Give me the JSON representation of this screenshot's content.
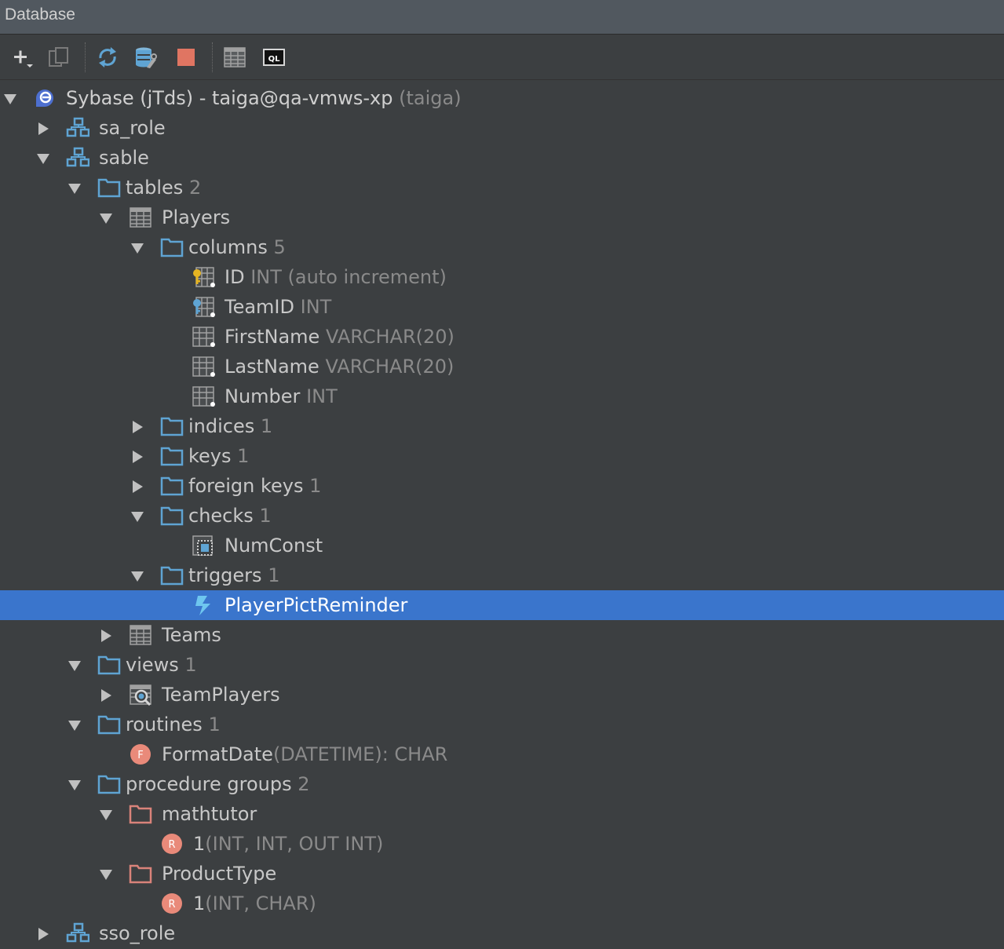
{
  "window": {
    "title": "Database"
  },
  "colors": {
    "selection": "#3a75cc",
    "folder": "#5fa4d3",
    "proc_folder": "#d9837a",
    "routine_badge": "#e98a7a"
  },
  "toolbar": {
    "buttons": [
      {
        "name": "add-icon"
      },
      {
        "name": "duplicate-icon"
      },
      {
        "name": "refresh-icon"
      },
      {
        "name": "properties-icon"
      },
      {
        "name": "stop-icon"
      },
      {
        "name": "table-editor-icon"
      },
      {
        "name": "console-icon",
        "text": "QL"
      }
    ]
  },
  "tree": {
    "rows": [
      {
        "label": "Sybase (jTds) - taiga@qa-vmws-xp",
        "meta": "(taiga)"
      },
      {
        "label": "sa_role",
        "meta": ""
      },
      {
        "label": "sable",
        "meta": ""
      },
      {
        "label": "tables",
        "meta": "2"
      },
      {
        "label": "Players",
        "meta": ""
      },
      {
        "label": "columns",
        "meta": "5"
      },
      {
        "label": "ID",
        "meta": "INT (auto increment)"
      },
      {
        "label": "TeamID",
        "meta": "INT"
      },
      {
        "label": "FirstName",
        "meta": "VARCHAR(20)"
      },
      {
        "label": "LastName",
        "meta": "VARCHAR(20)"
      },
      {
        "label": "Number",
        "meta": "INT"
      },
      {
        "label": "indices",
        "meta": "1"
      },
      {
        "label": "keys",
        "meta": "1"
      },
      {
        "label": "foreign keys",
        "meta": "1"
      },
      {
        "label": "checks",
        "meta": "1"
      },
      {
        "label": "NumConst",
        "meta": ""
      },
      {
        "label": "triggers",
        "meta": "1"
      },
      {
        "label": "PlayerPictReminder",
        "meta": ""
      },
      {
        "label": "Teams",
        "meta": ""
      },
      {
        "label": "views",
        "meta": "1"
      },
      {
        "label": "TeamPlayers",
        "meta": ""
      },
      {
        "label": "routines",
        "meta": "1"
      },
      {
        "label": "FormatDate",
        "meta": "(DATETIME): CHAR"
      },
      {
        "label": "procedure groups",
        "meta": "2"
      },
      {
        "label": "mathtutor",
        "meta": ""
      },
      {
        "label": "1",
        "meta": "(INT, INT, OUT INT)"
      },
      {
        "label": "ProductType",
        "meta": ""
      },
      {
        "label": "1",
        "meta": "(INT, CHAR)"
      },
      {
        "label": "sso_role",
        "meta": ""
      }
    ]
  },
  "badges": {
    "function": "F",
    "routine": "R"
  }
}
